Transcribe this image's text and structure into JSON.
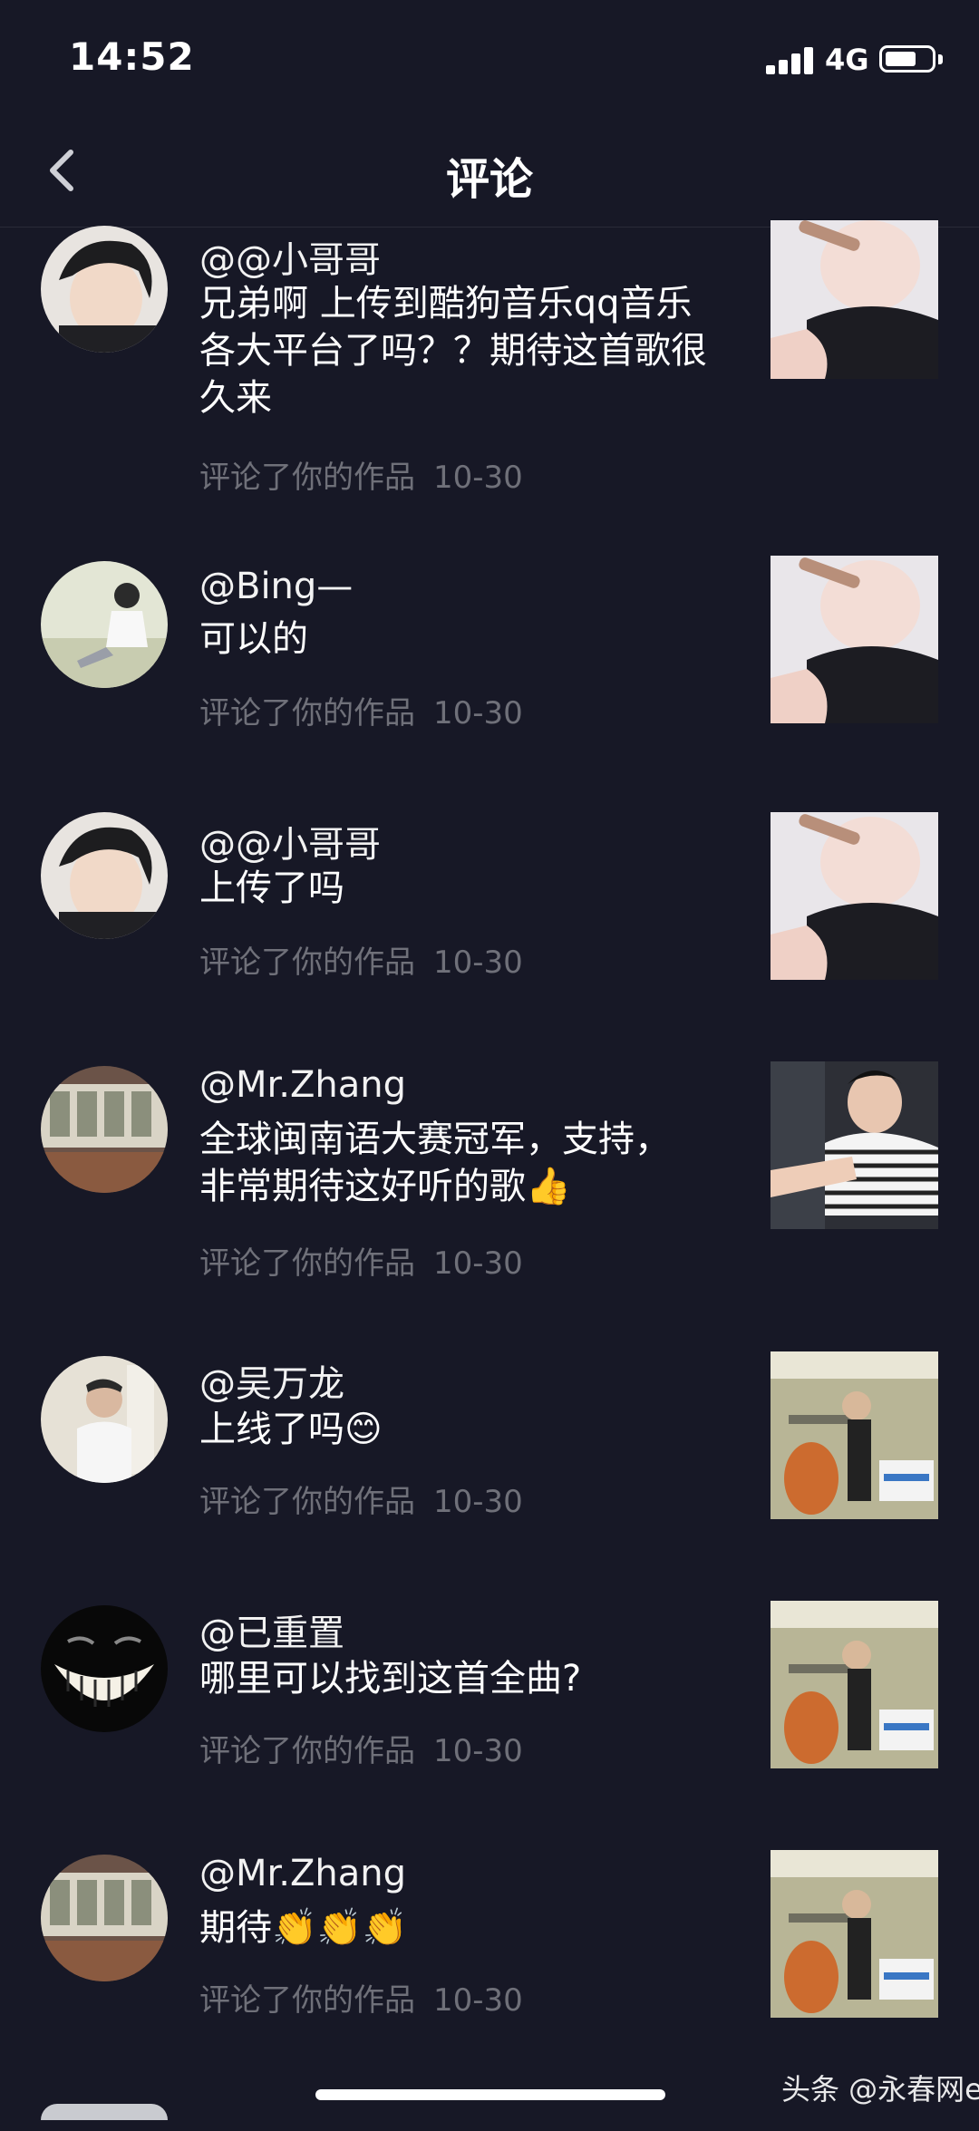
{
  "status_bar": {
    "time": "14:52",
    "network": "4G",
    "battery_level": 0.65
  },
  "header": {
    "title": "评论"
  },
  "comments": [
    {
      "username": "@@小哥哥",
      "text": "兄弟啊 上传到酷狗音乐qq音乐各大平台了吗？？期待这首歌很久来",
      "action": "评论了你的作品",
      "date": "10-30"
    },
    {
      "username": "@Bing—",
      "text": "可以的",
      "action": "评论了你的作品",
      "date": "10-30"
    },
    {
      "username": "@@小哥哥",
      "text": "上传了吗",
      "action": "评论了你的作品",
      "date": "10-30"
    },
    {
      "username": "@Mr.Zhang",
      "text": "全球闽南语大赛冠军，支持，非常期待这好听的歌👍",
      "action": "评论了你的作品",
      "date": "10-30"
    },
    {
      "username": "@吴万龙",
      "text": "上线了吗😊",
      "action": "评论了你的作品",
      "date": "10-30"
    },
    {
      "username": "@已重置",
      "text": "哪里可以找到这首全曲?",
      "action": "评论了你的作品",
      "date": "10-30"
    },
    {
      "username": "@Mr.Zhang",
      "text": "期待👏👏👏",
      "action": "评论了你的作品",
      "date": "10-30"
    }
  ],
  "watermark": "头条 @永春网e",
  "colors": {
    "background": "#171826",
    "meta_text": "#6f7079",
    "primary_text": "#ffffff"
  },
  "icons": {
    "back": "chevron-left-icon",
    "signal": "cellular-signal-icon",
    "battery": "battery-icon"
  }
}
